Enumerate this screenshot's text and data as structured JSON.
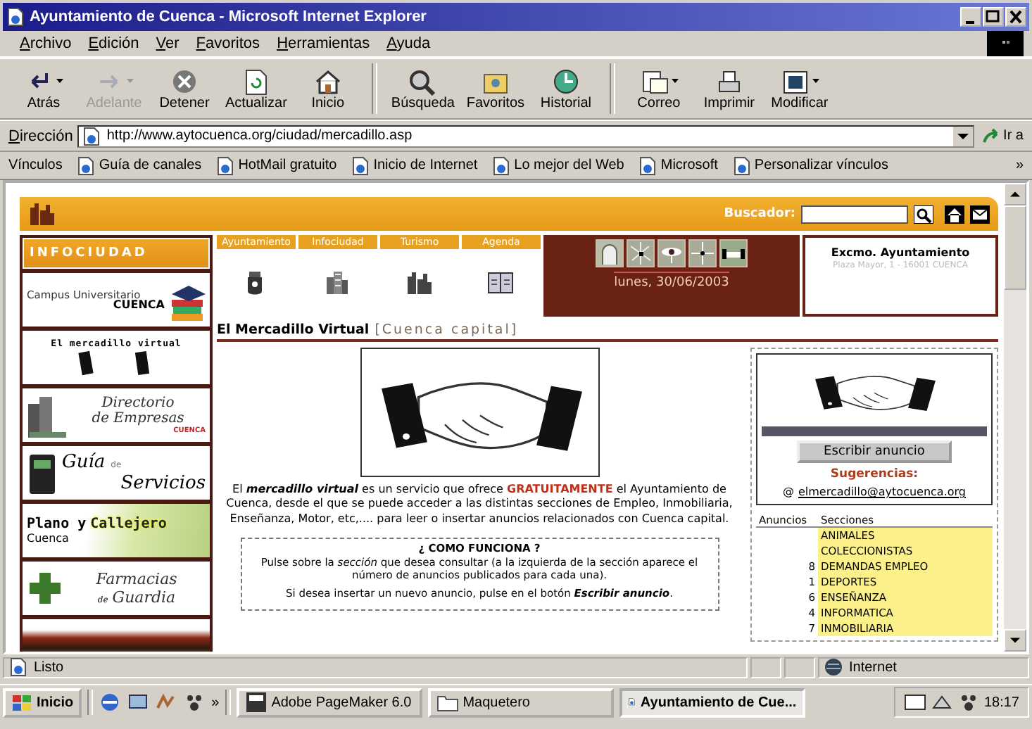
{
  "window": {
    "title": "Ayuntamiento de Cuenca - Microsoft Internet Explorer"
  },
  "menu": [
    "Archivo",
    "Edición",
    "Ver",
    "Favoritos",
    "Herramientas",
    "Ayuda"
  ],
  "toolbar": [
    [
      {
        "label": "Atrás",
        "disabled": false,
        "dropdown": true
      },
      {
        "label": "Adelante",
        "disabled": true,
        "dropdown": true
      },
      {
        "label": "Detener",
        "disabled": false,
        "dropdown": false
      },
      {
        "label": "Actualizar",
        "disabled": false,
        "dropdown": false
      },
      {
        "label": "Inicio",
        "disabled": false,
        "dropdown": false
      }
    ],
    [
      {
        "label": "Búsqueda",
        "disabled": false,
        "dropdown": false
      },
      {
        "label": "Favoritos",
        "disabled": false,
        "dropdown": false
      },
      {
        "label": "Historial",
        "disabled": false,
        "dropdown": false
      }
    ],
    [
      {
        "label": "Correo",
        "disabled": false,
        "dropdown": true
      },
      {
        "label": "Imprimir",
        "disabled": false,
        "dropdown": false
      },
      {
        "label": "Modificar",
        "disabled": false,
        "dropdown": true
      }
    ]
  ],
  "address": {
    "label": "Dirección",
    "value": "http://www.aytocuenca.org/ciudad/mercadillo.asp",
    "go": "Ir a"
  },
  "links": {
    "label": "Vínculos",
    "items": [
      "Guía de canales",
      "HotMail gratuito",
      "Inicio de Internet",
      "Lo mejor del Web",
      "Microsoft",
      "Personalizar vínculos"
    ],
    "more": "»"
  },
  "page": {
    "search": {
      "label": "Buscador:"
    },
    "sidebar": {
      "title": "INFOCIUDAD",
      "banners": [
        {
          "kind": "campus",
          "texts": [
            "Campus Universitario",
            "CUENCA"
          ]
        },
        {
          "kind": "mercadillo",
          "texts": [
            "El mercadillo virtual"
          ]
        },
        {
          "kind": "directorio",
          "texts": [
            "Directorio",
            "de Empresas",
            "CUENCA"
          ]
        },
        {
          "kind": "guia",
          "texts": [
            "Guía",
            "de",
            "Servicios"
          ]
        },
        {
          "kind": "plano",
          "texts": [
            "Plano y",
            "Callejero",
            "Cuenca"
          ]
        },
        {
          "kind": "farmacias",
          "texts": [
            "Farmacias",
            "de",
            "Guardia"
          ]
        },
        {
          "kind": "photo"
        }
      ]
    },
    "nav": [
      {
        "label": "Ayuntamiento"
      },
      {
        "label": "Infociudad"
      },
      {
        "label": "Turismo"
      },
      {
        "label": "Agenda"
      }
    ],
    "date": "lunes, 30/06/2003",
    "council": {
      "name": "Excmo. Ayuntamiento",
      "address": "Plaza Mayor, 1 - 16001 CUENCA"
    },
    "heading": {
      "title": "El Mercadillo Virtual",
      "link": "[Cuenca capital]"
    },
    "intro": [
      {
        "kind": "plain",
        "text": "El "
      },
      {
        "kind": "term",
        "text": "mercadillo virtual"
      },
      {
        "kind": "plain",
        "text": " es un servicio que ofrece "
      },
      {
        "kind": "highlight",
        "text": "GRATUITAMENTE"
      },
      {
        "kind": "plain",
        "text": " el Ayuntamiento de Cuenca, desde el que se puede acceder a las distintas secciones de Empleo, Inmobiliaria, Enseñanza, Motor, etc,.... para leer o insertar anuncios relacionados con Cuenca capital."
      }
    ],
    "how": {
      "title": "¿ COMO FUNCIONA ?",
      "lines": [
        "Pulse sobre la *sección* que desea consultar (a la izquierda de la sección aparece el número de anuncios publicados para cada una).",
        "Si desea insertar un nuevo anuncio, pulse en el botón **Escribir anuncio**."
      ]
    },
    "write_button": "Escribir anuncio",
    "suggestions": {
      "label": "Sugerencias:",
      "at": "@",
      "email": "elmercadillo@aytocuenca.org"
    },
    "sections": {
      "columns": [
        "Anuncios",
        "Secciones"
      ],
      "rows": [
        {
          "count": "",
          "name": "ANIMALES"
        },
        {
          "count": "",
          "name": "COLECCIONISTAS"
        },
        {
          "count": "8",
          "name": "DEMANDAS EMPLEO"
        },
        {
          "count": "1",
          "name": "DEPORTES"
        },
        {
          "count": "6",
          "name": "ENSEÑANZA"
        },
        {
          "count": "4",
          "name": "INFORMATICA"
        },
        {
          "count": "7",
          "name": "INMOBILIARIA"
        }
      ]
    }
  },
  "status_bar": {
    "text": "Listo",
    "zone": "Internet"
  },
  "taskbar": {
    "start": "Inicio",
    "more": "»",
    "tasks": [
      {
        "label": "Adobe PageMaker 6.0",
        "selected": false
      },
      {
        "label": "Maquetero",
        "selected": false
      },
      {
        "label": "Ayuntamiento de Cue...",
        "selected": true
      }
    ],
    "clock": "18:17"
  }
}
